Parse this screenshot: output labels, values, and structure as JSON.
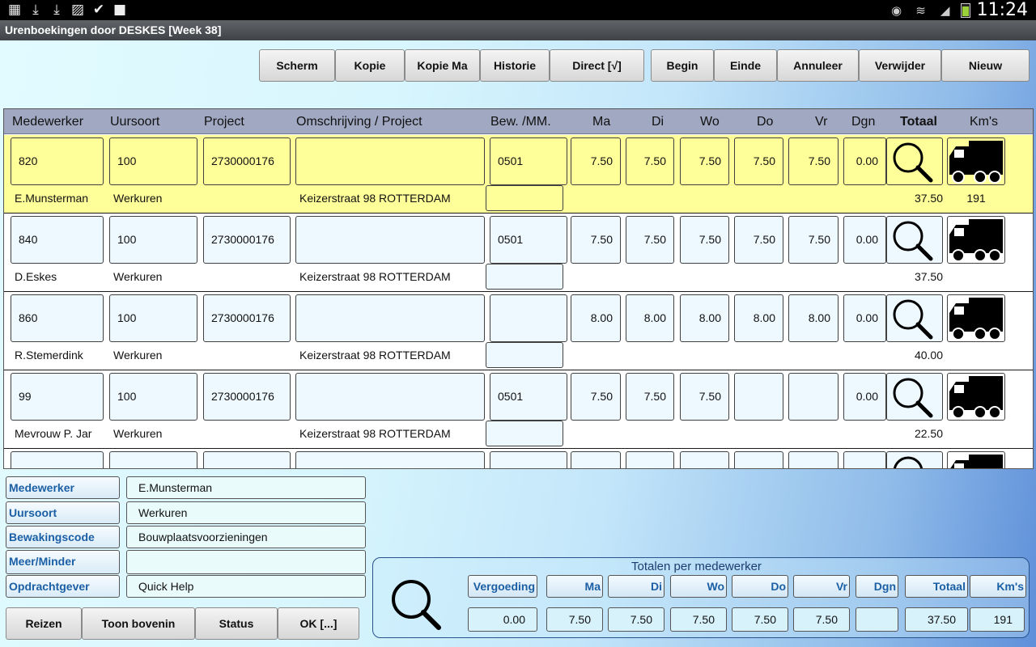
{
  "status_bar": {
    "left_icons": [
      "sim-card-icon",
      "download-icon",
      "download-icon",
      "image-icon",
      "clipboard-check-icon",
      "camera-icon"
    ],
    "right_icons": [
      "eye-icon",
      "wifi-icon",
      "signal-icon",
      "battery-icon"
    ],
    "battery_level": 0.75,
    "time": "11:24"
  },
  "title": "Urenboekingen door DESKES  [Week 38]",
  "toolbar": {
    "scherm": "Scherm",
    "kopie": "Kopie",
    "kopie_ma": "Kopie Ma",
    "historie": "Historie",
    "direct": "Direct [√]",
    "begin": "Begin",
    "einde": "Einde",
    "annuleer": "Annuleer",
    "verwijder": "Verwijder",
    "nieuw": "Nieuw"
  },
  "columns": {
    "medewerker": "Medewerker",
    "uursoort": "Uursoort",
    "project": "Project",
    "omschrijving": "Omschrijving / Project",
    "bew": "Bew. /MM.",
    "ma": "Ma",
    "di": "Di",
    "wo": "Wo",
    "do": "Do",
    "vr": "Vr",
    "dgn": "Dgn",
    "totaal": "Totaal",
    "kms": "Km's"
  },
  "rows": [
    {
      "medewerker": "820",
      "uursoort": "100",
      "project": "2730000176",
      "omschrijving": "",
      "bew": "0501",
      "ma": "7.50",
      "di": "7.50",
      "wo": "7.50",
      "do": "7.50",
      "vr": "7.50",
      "dgn": "0.00",
      "name": "E.Munsterman",
      "uursoort_name": "Werkuren",
      "address": "Keizerstraat 98 ROTTERDAM",
      "totaal": "37.50",
      "kms": "191"
    },
    {
      "medewerker": "840",
      "uursoort": "100",
      "project": "2730000176",
      "omschrijving": "",
      "bew": "0501",
      "ma": "7.50",
      "di": "7.50",
      "wo": "7.50",
      "do": "7.50",
      "vr": "7.50",
      "dgn": "0.00",
      "name": "D.Eskes",
      "uursoort_name": "Werkuren",
      "address": "Keizerstraat 98 ROTTERDAM",
      "totaal": "37.50",
      "kms": ""
    },
    {
      "medewerker": "860",
      "uursoort": "100",
      "project": "2730000176",
      "omschrijving": "",
      "bew": "",
      "ma": "8.00",
      "di": "8.00",
      "wo": "8.00",
      "do": "8.00",
      "vr": "8.00",
      "dgn": "0.00",
      "name": "R.Stemerdink",
      "uursoort_name": "Werkuren",
      "address": "Keizerstraat 98 ROTTERDAM",
      "totaal": "40.00",
      "kms": ""
    },
    {
      "medewerker": "99",
      "uursoort": "100",
      "project": "2730000176",
      "omschrijving": "",
      "bew": "0501",
      "ma": "7.50",
      "di": "7.50",
      "wo": "7.50",
      "do": "",
      "vr": "",
      "dgn": "0.00",
      "name": "Mevrouw P. Jar",
      "uursoort_name": "Werkuren",
      "address": "Keizerstraat 98 ROTTERDAM",
      "totaal": "22.50",
      "kms": ""
    }
  ],
  "detail": {
    "medewerker_label": "Medewerker",
    "medewerker_value": "E.Munsterman",
    "uursoort_label": "Uursoort",
    "uursoort_value": "Werkuren",
    "bewaking_label": "Bewakingscode",
    "bewaking_value": "Bouwplaatsvoorzieningen",
    "meerminder_label": "Meer/Minder",
    "meerminder_value": "",
    "opdrachtgever_label": "Opdrachtgever",
    "opdrachtgever_value": "Quick Help"
  },
  "bottom_buttons": {
    "reizen": "Reizen",
    "toon_bovenin": "Toon bovenin",
    "status": "Status",
    "ok": "OK [...]"
  },
  "totals": {
    "title": "Totalen per medewerker",
    "headers": {
      "vergoeding": "Vergoeding",
      "ma": "Ma",
      "di": "Di",
      "wo": "Wo",
      "do": "Do",
      "vr": "Vr",
      "dgn": "Dgn",
      "totaal": "Totaal",
      "kms": "Km's"
    },
    "values": {
      "vergoeding": "0.00",
      "ma": "7.50",
      "di": "7.50",
      "wo": "7.50",
      "do": "7.50",
      "vr": "7.50",
      "dgn": "",
      "totaal": "37.50",
      "kms": "191"
    }
  },
  "colors": {
    "selected_row": "#ffff99",
    "label_text": "#1b5fa5",
    "header_bg": "#a1a9c2"
  }
}
